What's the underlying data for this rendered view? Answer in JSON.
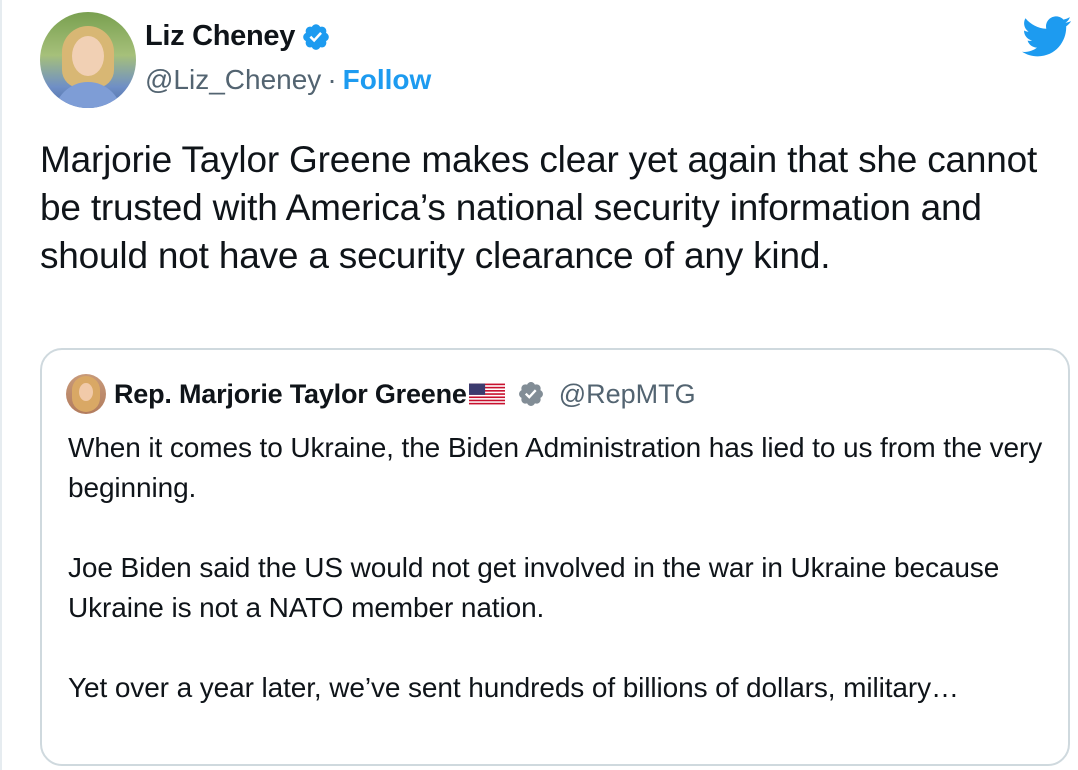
{
  "author": {
    "display_name": "Liz Cheney",
    "handle": "@Liz_Cheney",
    "separator": "·",
    "follow_label": "Follow",
    "verified": true
  },
  "tweet": {
    "text": "Marjorie Taylor Greene makes clear yet again that she cannot be trusted with America’s national security information and should not have a security clearance of any kind."
  },
  "quote": {
    "display_name": "Rep. Marjorie Taylor Greene",
    "handle": "@RepMTG",
    "verified": true,
    "paragraphs": [
      "When it comes to Ukraine, the Biden Administration has lied to us from the very beginning.",
      "Joe Biden said the US would not get involved in the war in Ukraine because Ukraine is not a NATO member nation.",
      "Yet over a year later, we’ve sent hundreds of billions of dollars, military…"
    ]
  },
  "icons": {
    "brand": "twitter-bird-icon",
    "verified": "verified-badge-icon",
    "flag": "us-flag-icon"
  },
  "colors": {
    "brand_blue": "#1d9bf0",
    "text": "#0f1419",
    "secondary": "#536471",
    "quote_verified_gray": "#828d96",
    "border": "#cfd9de"
  }
}
